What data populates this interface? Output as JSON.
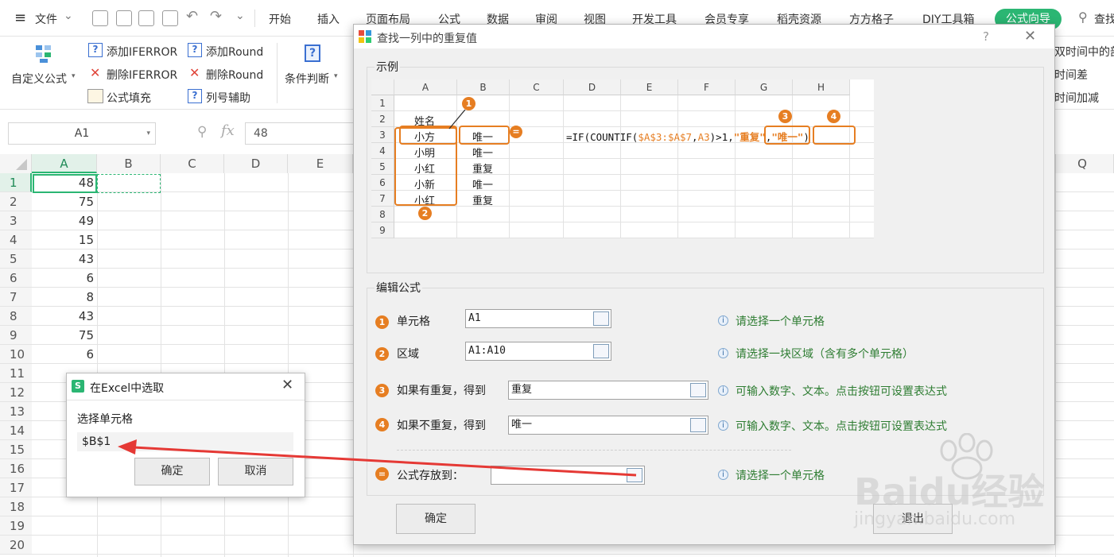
{
  "menubar": {
    "file_label": "文件",
    "tabs": [
      "开始",
      "插入",
      "页面布局",
      "公式",
      "数据",
      "审阅",
      "视图",
      "开发工具",
      "会员专享",
      "稻壳资源",
      "方方格子",
      "DIY工具箱"
    ],
    "active_tab": "公式向导",
    "search_label": "查找"
  },
  "ribbon": {
    "custom_formula": "自定义公式",
    "add_iferror": "添加IFERROR",
    "del_iferror": "删除IFERROR",
    "formula_fill": "公式填充",
    "add_round": "添加Round",
    "del_round": "删除Round",
    "col_assist": "列号辅助",
    "condition": "条件判断",
    "right_1": "双时间中的部",
    "right_2": "时间差",
    "right_3": "时间加减"
  },
  "formulabar": {
    "namebox": "A1",
    "fx": "fx",
    "value": "48"
  },
  "grid": {
    "columns": [
      "A",
      "B",
      "C",
      "D",
      "E"
    ],
    "right_column": "Q",
    "rows": [
      "1",
      "2",
      "3",
      "4",
      "5",
      "6",
      "7",
      "8",
      "9",
      "10",
      "11",
      "12",
      "13",
      "14",
      "15",
      "16",
      "17",
      "18",
      "19",
      "20"
    ],
    "col_a_values": [
      "48",
      "75",
      "49",
      "15",
      "43",
      "6",
      "8",
      "43",
      "75",
      "6"
    ]
  },
  "picker": {
    "title": "在Excel中选取",
    "prompt": "选择单元格",
    "value": "$B$1",
    "ok": "确定",
    "cancel": "取消"
  },
  "dialog": {
    "title": "查找一列中的重复值",
    "help": "?",
    "example_title": "示例",
    "edit_title": "编辑公式",
    "fields": [
      {
        "badge": "1",
        "label": "单元格",
        "value": "A1",
        "hint": "请选择一个单元格"
      },
      {
        "badge": "2",
        "label": "区域",
        "value": "A1:A10",
        "hint": "请选择一块区域（含有多个单元格）"
      },
      {
        "badge": "3",
        "label": "如果有重复，得到",
        "value": "重复",
        "hint": "可输入数字、文本。点击按钮可设置表达式"
      },
      {
        "badge": "4",
        "label": "如果不重复，得到",
        "value": "唯一",
        "hint": "可输入数字、文本。点击按钮可设置表达式"
      },
      {
        "badge": "=",
        "label": "公式存放到：",
        "value": "",
        "hint": "请选择一个单元格"
      }
    ],
    "ok": "确定",
    "exit": "退出"
  },
  "example": {
    "columns": [
      "A",
      "B",
      "C",
      "D",
      "E",
      "F",
      "G",
      "H"
    ],
    "rows": [
      "1",
      "2",
      "3",
      "4",
      "5",
      "6",
      "7",
      "8",
      "9"
    ],
    "a_header": "姓名",
    "names": [
      "小方",
      "小明",
      "小红",
      "小新",
      "小红"
    ],
    "results": [
      "唯一",
      "唯一",
      "重复",
      "唯一",
      "重复"
    ],
    "formula_parts": {
      "prefix": "=IF(COUNTIF(",
      "range": "$A$3:$A$7",
      "comma": ",",
      "cell": "A3",
      "mid": ")>1,",
      "dup": "\"重复\"",
      "sep": ",",
      "uniq": "\"唯一\"",
      "end": ")"
    },
    "badges": [
      "1",
      "2",
      "3",
      "4",
      "="
    ]
  },
  "watermark": {
    "brand": "Baidu经验",
    "url": "jingyan.baidu.com"
  },
  "colors": {
    "accent_green": "#2bb673",
    "orange": "#e67e22",
    "arrow_red": "#e53935",
    "hint_green": "#2e7d32"
  }
}
